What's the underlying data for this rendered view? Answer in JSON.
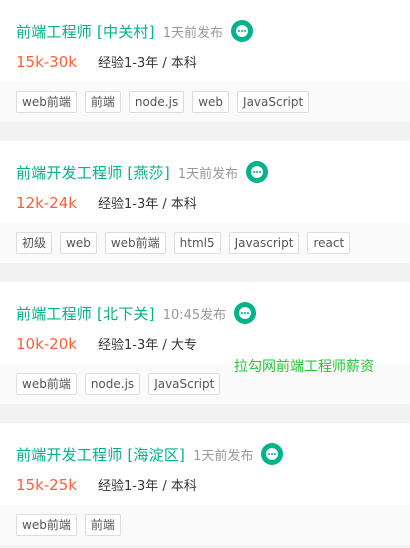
{
  "jobs": [
    {
      "title": "前端工程师 [中关村]",
      "time": "1天前发布",
      "salary": "15k-30k",
      "requirement": "经验1-3年 / 本科",
      "tags": [
        "web前端",
        "前端",
        "node.js",
        "web",
        "JavaScript"
      ]
    },
    {
      "title": "前端开发工程师 [燕莎]",
      "time": "1天前发布",
      "salary": "12k-24k",
      "requirement": "经验1-3年 / 本科",
      "tags": [
        "初级",
        "web",
        "web前端",
        "html5",
        "Javascript",
        "react"
      ]
    },
    {
      "title": "前端工程师 [北下关]",
      "time": "10:45发布",
      "salary": "10k-20k",
      "requirement": "经验1-3年 / 大专",
      "tags": [
        "web前端",
        "node.js",
        "JavaScript"
      ]
    },
    {
      "title": "前端开发工程师 [海淀区]",
      "time": "1天前发布",
      "salary": "15k-25k",
      "requirement": "经验1-3年 / 本科",
      "tags": [
        "web前端",
        "前端"
      ]
    }
  ],
  "ad": {
    "text": "拉勾网前端工程师薪资"
  },
  "icons": {
    "chat": "chat-bubble-icon"
  },
  "colors": {
    "title": "#00b38a",
    "salary": "#fd5f39",
    "ad": "#26c63a"
  }
}
